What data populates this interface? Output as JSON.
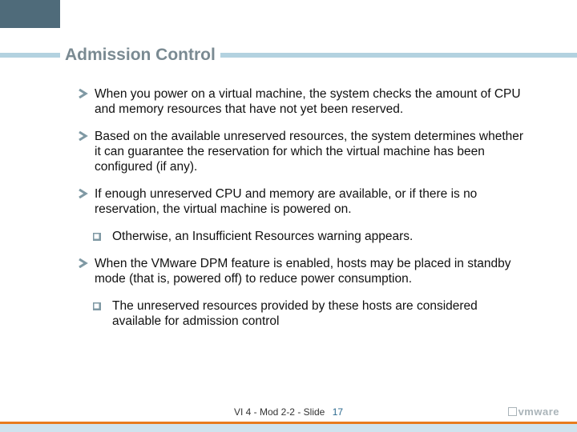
{
  "title": "Admission Control",
  "bullets": [
    {
      "level": 1,
      "text": "When you power on a virtual machine, the system checks the amount of CPU and memory resources that have not yet been reserved."
    },
    {
      "level": 1,
      "text": "Based on the available unreserved resources, the system determines whether it can guarantee the reservation for which the virtual machine has been configured (if any)."
    },
    {
      "level": 1,
      "text": "If enough unreserved CPU and memory are available, or if there is no reservation, the virtual machine is powered on."
    },
    {
      "level": 2,
      "text": "Otherwise, an Insufficient Resources warning appears."
    },
    {
      "level": 1,
      "text": "When the VMware DPM feature is enabled, hosts may be placed in standby mode (that is, powered off) to reduce power consumption."
    },
    {
      "level": 2,
      "text": "The unreserved resources provided by these hosts are considered available for admission control"
    }
  ],
  "footer": {
    "label": "VI 4 - Mod 2-2 - Slide",
    "page": "17"
  },
  "brand": "vmware",
  "icons": {
    "arrow_color": "#7f99a4",
    "square_color": "#7f99a4"
  }
}
